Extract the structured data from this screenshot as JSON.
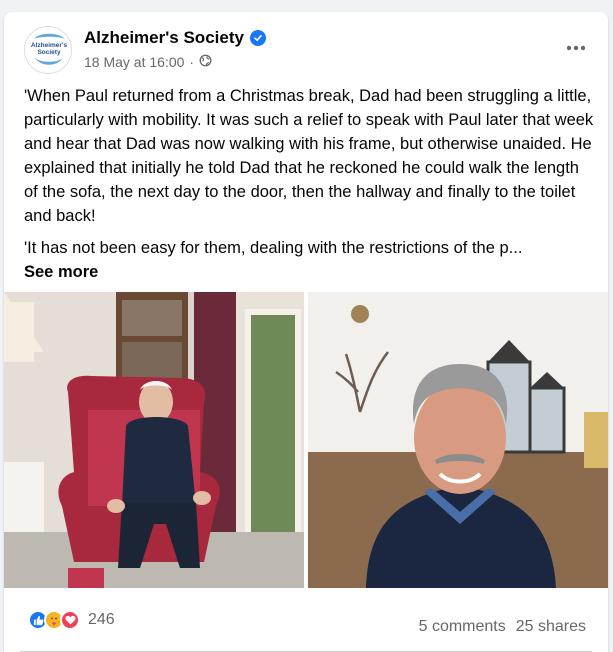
{
  "post": {
    "author": "Alzheimer's Society",
    "timestamp": "18 May at 16:00",
    "audience_icon": "globe-icon",
    "logo_text_1": "Alzheimer's",
    "logo_text_2": "Society",
    "paragraph_1": "'When Paul returned from a Christmas break, Dad had been struggling a little, particularly with mobility. It was such a relief to speak with Paul later that week and hear that Dad was now walking with his frame, but otherwise unaided. He explained that initially he told Dad that he reckoned he could walk the length of the sofa, the next day to the door, then the hallway and finally to the toilet and back!",
    "paragraph_2": "'It has not been easy for them, dealing with the restrictions of the p...",
    "see_more": "See more"
  },
  "footer": {
    "reaction_icons": [
      "like-icon",
      "care-icon",
      "love-icon"
    ],
    "reaction_count": "246",
    "comments": "5 comments",
    "shares": "25 shares"
  },
  "colors": {
    "brand_blue": "#1877f2",
    "love_red": "#f33e58",
    "care_yellow": "#f7b125",
    "secondary_text": "#65676b"
  }
}
